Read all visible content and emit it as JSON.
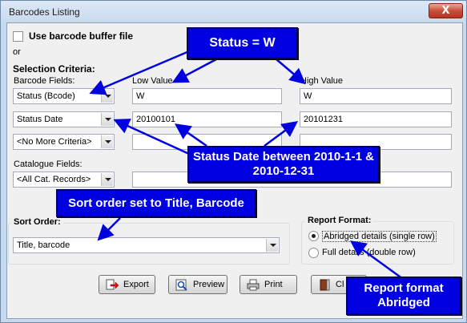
{
  "window": {
    "title": "Barcodes Listing",
    "close_glyph": "X"
  },
  "buffer": {
    "label": "Use barcode buffer file",
    "checked": false
  },
  "or_text": "or",
  "selection": {
    "title": "Selection Criteria:",
    "barcode_fields_label": "Barcode Fields:",
    "low_value_label": "Low Value",
    "high_value_label": "High Value",
    "rows": [
      {
        "field": "Status (Bcode)",
        "low": "W",
        "high": "W"
      },
      {
        "field": "Status Date",
        "low": "20100101",
        "high": "20101231"
      },
      {
        "field": "<No More Criteria>",
        "low": "",
        "high": ""
      }
    ],
    "catalogue_label": "Catalogue Fields:",
    "catalogue_value": "<All Cat. Records>",
    "catalogue_text": ""
  },
  "sort": {
    "label": "Sort Order:",
    "value": "Title, barcode"
  },
  "report": {
    "title": "Report Format:",
    "options": [
      {
        "label": "Abridged details (single row)",
        "selected": true
      },
      {
        "label": "Full details (double row)",
        "selected": false
      }
    ]
  },
  "buttons": {
    "export": "Export",
    "preview": "Preview",
    "print": "Print",
    "close": "Cl"
  },
  "callouts": {
    "status": "Status = W",
    "status_date": "Status Date between 2010-1-1 & 2010-12-31",
    "sort_order": "Sort order set to Title, Barcode",
    "report_format": "Report format Abridged"
  },
  "colors": {
    "callout_bg": "#0000e0",
    "arrow": "#0000e0"
  }
}
